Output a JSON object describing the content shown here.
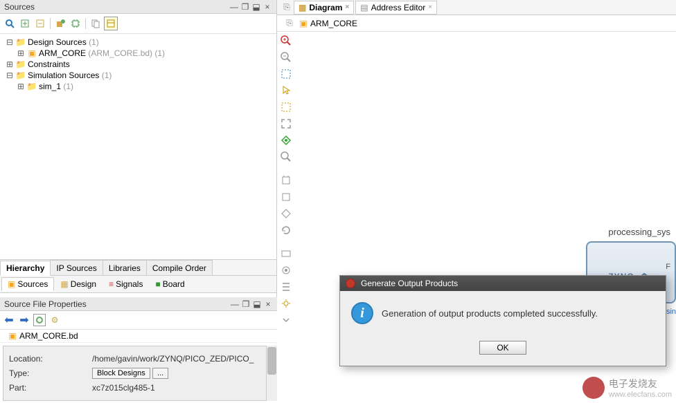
{
  "sources_panel": {
    "title": "Sources",
    "tree": {
      "design_sources": {
        "label": "Design Sources",
        "count": "(1)"
      },
      "arm_core": {
        "label": "ARM_CORE",
        "detail": "(ARM_CORE.bd) (1)"
      },
      "constraints": {
        "label": "Constraints"
      },
      "simulation_sources": {
        "label": "Simulation Sources",
        "count": "(1)"
      },
      "sim_1": {
        "label": "sim_1",
        "count": "(1)"
      }
    },
    "bottom_tabs": [
      "Hierarchy",
      "IP Sources",
      "Libraries",
      "Compile Order"
    ],
    "sub_tabs": [
      "Sources",
      "Design",
      "Signals",
      "Board"
    ]
  },
  "properties_panel": {
    "title": "Source File Properties",
    "file": "ARM_CORE.bd",
    "rows": {
      "location": {
        "label": "Location:",
        "value": "/home/gavin/work/ZYNQ/PICO_ZED/PICO_"
      },
      "type": {
        "label": "Type:",
        "value": "Block Designs",
        "button": "..."
      },
      "part": {
        "label": "Part:",
        "value": "xc7z015clg485-1"
      }
    }
  },
  "diagram": {
    "tabs": [
      {
        "label": "Diagram",
        "closable": true,
        "active": true
      },
      {
        "label": "Address Editor",
        "closable": true,
        "active": false
      }
    ],
    "bd_name": "ARM_CORE",
    "block": {
      "instance": "processing_sys",
      "logo": "ZYNQ",
      "port_r": "F",
      "sub": "Processin"
    }
  },
  "dialog": {
    "title": "Generate Output Products",
    "message": "Generation of output products completed successfully.",
    "ok": "OK"
  },
  "watermark": {
    "brand": "电子发烧友",
    "url": "www.elecfans.com"
  }
}
